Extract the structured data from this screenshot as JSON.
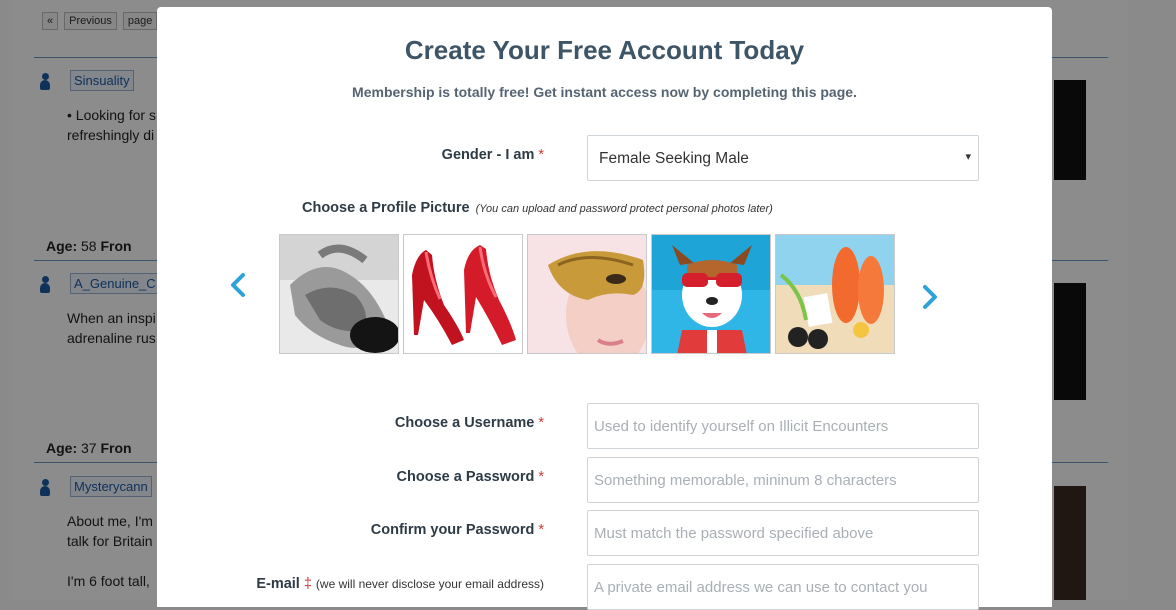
{
  "background": {
    "pager": [
      "«",
      "Previous",
      "page"
    ],
    "members": [
      {
        "username": "Sinsuality",
        "text": "• Looking for s\nrefreshingly di",
        "age_label": "Age:",
        "age": "58",
        "from_label": "Fron"
      },
      {
        "username": "A_Genuine_C",
        "text": "When an inspi\nadrenaline rus",
        "age_label": "Age:",
        "age": "37",
        "from_label": "Fron"
      },
      {
        "username": "Mysterycann",
        "text": "About me, I'm\ntalk for Britain\n\nI'm 6 foot tall,",
        "age_label": "",
        "age": "",
        "from_label": ""
      }
    ]
  },
  "modal": {
    "title": "Create Your Free Account Today",
    "subtitle": "Membership is totally free! Get instant access now by completing this page.",
    "gender": {
      "label": "Gender - I am",
      "required_mark": "*",
      "value": "Female Seeking Male",
      "caret": "▾"
    },
    "profile_picture": {
      "label": "Choose a Profile Picture",
      "hint": "(You can upload and password protect personal photos later)",
      "thumbnails": [
        "bw-body",
        "red-heels",
        "gold-mask",
        "dog-sunglasses",
        "beach-flipflops"
      ]
    },
    "username": {
      "label": "Choose a Username",
      "required_mark": "*",
      "placeholder": "Used to identify yourself on Illicit Encounters"
    },
    "password": {
      "label": "Choose a Password",
      "required_mark": "*",
      "placeholder": "Something memorable, mininum 8 characters"
    },
    "confirm": {
      "label": "Confirm your Password",
      "required_mark": "*",
      "placeholder": "Must match the password specified above"
    },
    "email": {
      "label": "E-mail",
      "required_mark": "‡",
      "note": "(we will never disclose your email address)",
      "placeholder": "A private email address we can use to contact you"
    }
  },
  "colors": {
    "accent": "#2fa3d9",
    "required": "#d23a3a",
    "title": "#3d5566"
  }
}
